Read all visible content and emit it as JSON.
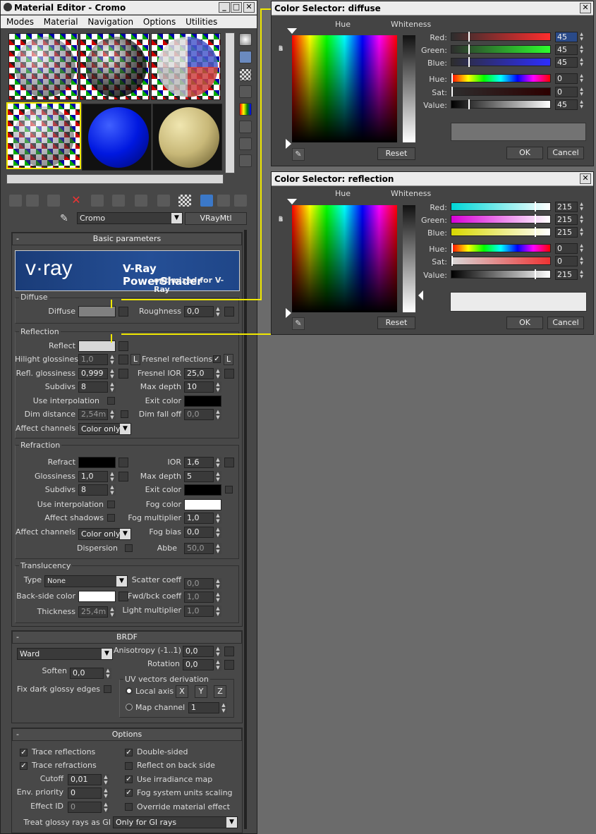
{
  "me": {
    "title": "Material Editor - Cromo",
    "menu": [
      "Modes",
      "Material",
      "Navigation",
      "Options",
      "Utilities"
    ],
    "material_name": "Cromo",
    "material_type": "VRayMtl"
  },
  "basic": {
    "title": "Basic parameters",
    "banner_brand": "v·ray",
    "banner_title": "V-Ray PowerShader",
    "banner_sub": "optimized for V-Ray"
  },
  "diffuse": {
    "group": "Diffuse",
    "label": "Diffuse",
    "roughness_label": "Roughness",
    "roughness": "0,0"
  },
  "reflection": {
    "group": "Reflection",
    "reflect": "Reflect",
    "hilight_label": "Hilight glossiness",
    "hilight": "1,0",
    "L": "L",
    "fresnel_label": "Fresnel reflections",
    "refl_gloss_label": "Refl. glossiness",
    "refl_gloss": "0,999",
    "fresnel_ior_label": "Fresnel IOR",
    "fresnel_ior": "25,0",
    "subdivs_label": "Subdivs",
    "subdivs": "8",
    "maxdepth_label": "Max depth",
    "maxdepth": "10",
    "useinterp_label": "Use interpolation",
    "exit_label": "Exit color",
    "dimdist_label": "Dim distance",
    "dimdist": "2,54m",
    "dimfall_label": "Dim fall off",
    "dimfall": "0,0",
    "affect_label": "Affect channels",
    "affect": "Color only"
  },
  "refraction": {
    "group": "Refraction",
    "refract": "Refract",
    "ior_label": "IOR",
    "ior": "1,6",
    "gloss_label": "Glossiness",
    "gloss": "1,0",
    "maxdepth_label": "Max depth",
    "maxdepth": "5",
    "subdivs_label": "Subdivs",
    "subdivs": "8",
    "exit_label": "Exit color",
    "useinterp_label": "Use interpolation",
    "fog_label": "Fog color",
    "shadows_label": "Affect shadows",
    "fogmult_label": "Fog multiplier",
    "fogmult": "1,0",
    "affect_label": "Affect channels",
    "affect": "Color only",
    "fogbias_label": "Fog bias",
    "fogbias": "0,0",
    "dispersion_label": "Dispersion",
    "abbe_label": "Abbe",
    "abbe": "50,0"
  },
  "translucency": {
    "group": "Translucency",
    "type_label": "Type",
    "type": "None",
    "scatter_label": "Scatter coeff",
    "scatter": "0,0",
    "backside_label": "Back-side color",
    "fwd_label": "Fwd/bck coeff",
    "fwd": "1,0",
    "thick_label": "Thickness",
    "thick": "25,4m",
    "light_label": "Light multiplier",
    "light": "1,0"
  },
  "brdf": {
    "title": "BRDF",
    "type": "Ward",
    "aniso_label": "Anisotropy (-1..1)",
    "aniso": "0,0",
    "rot_label": "Rotation",
    "rot": "0,0",
    "soften_label": "Soften",
    "soften": "0,0",
    "uv_group": "UV vectors derivation",
    "local": "Local axis",
    "x": "X",
    "y": "Y",
    "z": "Z",
    "fixdark_label": "Fix dark glossy edges",
    "mapch": "Map channel",
    "mapch_val": "1"
  },
  "options": {
    "title": "Options",
    "trace_refl": "Trace reflections",
    "double": "Double-sided",
    "trace_refr": "Trace refractions",
    "reflback": "Reflect on back side",
    "cutoff_label": "Cutoff",
    "cutoff": "0,01",
    "irr": "Use irradiance map",
    "env_label": "Env. priority",
    "env": "0",
    "fog": "Fog system units scaling",
    "effect_label": "Effect ID",
    "effect": "0",
    "override": "Override material effect",
    "glossy_label": "Treat glossy rays as GI",
    "glossy": "Only for GI rays"
  },
  "cs1": {
    "title": "Color Selector: diffuse",
    "hue": "Hue",
    "whiteness": "Whiteness",
    "blackness": [
      "B",
      "l",
      "a",
      "c",
      "k",
      "n",
      "e",
      "s",
      "s"
    ],
    "red_l": "Red:",
    "green_l": "Green:",
    "blue_l": "Blue:",
    "hue_l": "Hue:",
    "sat_l": "Sat:",
    "val_l": "Value:",
    "red": "45",
    "green": "45",
    "blue": "45",
    "h": "0",
    "s": "0",
    "v": "45",
    "swatch": "#2d2d2d",
    "reset": "Reset",
    "ok": "OK",
    "cancel": "Cancel"
  },
  "cs2": {
    "title": "Color Selector: reflection",
    "hue": "Hue",
    "whiteness": "Whiteness",
    "blackness": [
      "B",
      "l",
      "a",
      "c",
      "k",
      "n",
      "e",
      "s",
      "s"
    ],
    "red_l": "Red:",
    "green_l": "Green:",
    "blue_l": "Blue:",
    "hue_l": "Hue:",
    "sat_l": "Sat:",
    "val_l": "Value:",
    "red": "215",
    "green": "215",
    "blue": "215",
    "h": "0",
    "s": "0",
    "v": "215",
    "swatch": "#d7d7d7",
    "reset": "Reset",
    "ok": "OK",
    "cancel": "Cancel"
  },
  "colors": {
    "accent_link": "#f0e800",
    "diffuse_swatch": "#808080",
    "reflect_swatch": "#d7d7d7"
  }
}
